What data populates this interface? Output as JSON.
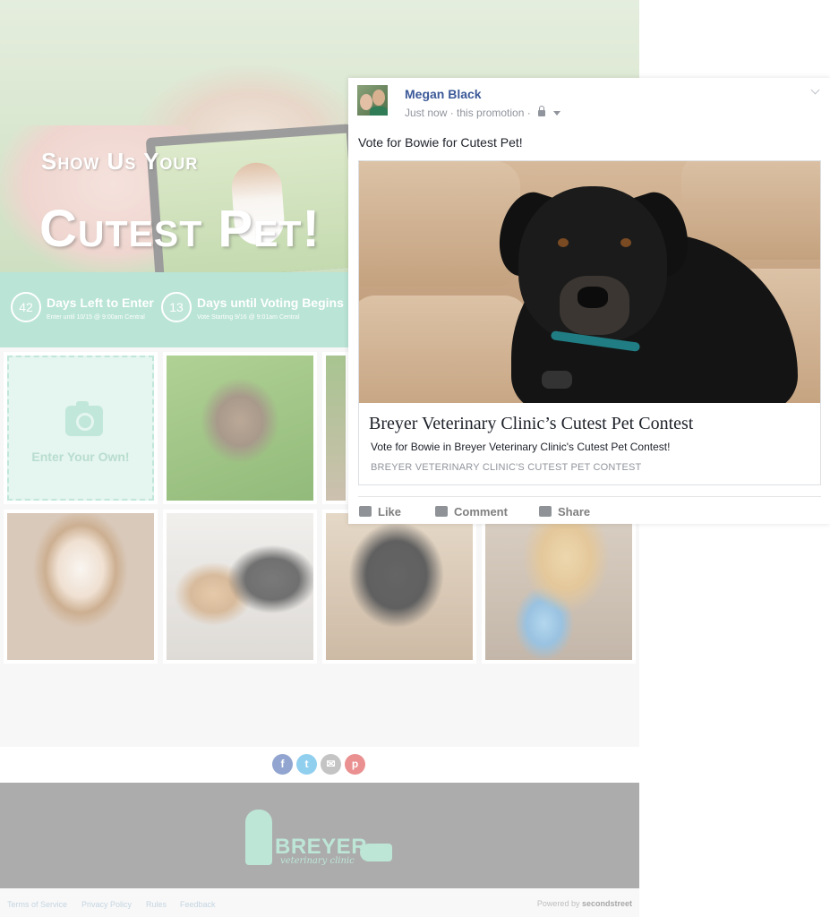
{
  "contest": {
    "hero_line1": "Show Us Your",
    "hero_line2": "Cutest Pet!",
    "countdown": [
      {
        "number": "42",
        "label": "Days Left to Enter",
        "sub": "Enter until 10/15 @ 9:00am Central"
      },
      {
        "number": "13",
        "label": "Days until Voting Begins",
        "sub": "Vote Starting 9/16 @ 9:01am Central"
      }
    ],
    "enter_label": "Enter Your Own!",
    "share": [
      {
        "icon": "facebook-icon",
        "glyph": "f",
        "color": "#5d7bba"
      },
      {
        "icon": "twitter-icon",
        "glyph": "t",
        "color": "#5db8e8"
      },
      {
        "icon": "email-icon",
        "glyph": "✉",
        "color": "#a9a9a9"
      },
      {
        "icon": "pinterest-icon",
        "glyph": "p",
        "color": "#e05c5c"
      }
    ],
    "footer": {
      "brand": "BREYER",
      "brand_sub": "veterinary clinic"
    },
    "legal_links": [
      "Terms of Service",
      "Privacy Policy",
      "Rules",
      "Feedback"
    ],
    "powered_by": "Powered by",
    "powered_brand": "secondstreet"
  },
  "post": {
    "author": "Megan Black",
    "meta": "Just now · this promotion ·",
    "status": "Vote for Bowie for Cutest Pet!",
    "link_title": "Breyer Veterinary Clinic’s Cutest Pet Contest",
    "link_description": "Vote for Bowie in Breyer Veterinary Clinic's Cutest Pet Contest!",
    "link_domain": "BREYER VETERINARY CLINIC'S CUTEST PET CONTEST",
    "actions": {
      "like": "Like",
      "comment": "Comment",
      "share": "Share"
    }
  },
  "colors": {
    "accent": "#9ad8c3",
    "fb_blue": "#3b5998"
  }
}
